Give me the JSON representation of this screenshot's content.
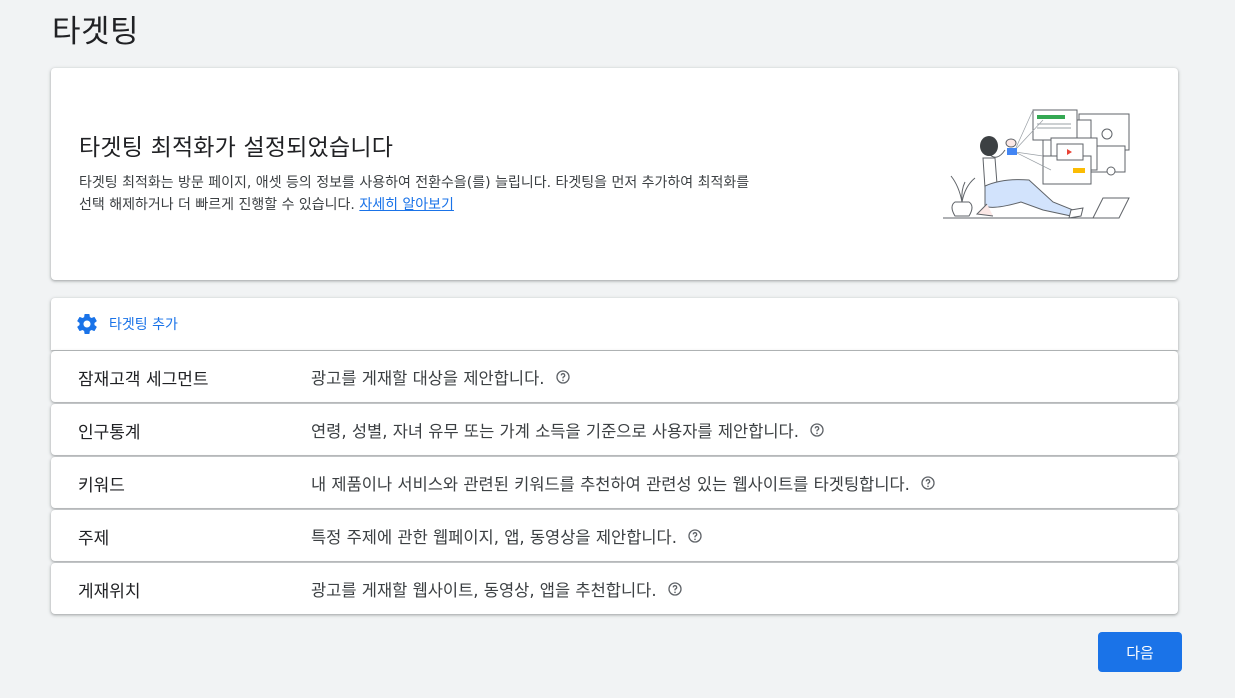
{
  "page": {
    "title": "타겟팅"
  },
  "banner": {
    "heading": "타겟팅 최적화가 설정되었습니다",
    "description_line1": "타겟팅 최적화는 방문 페이지, 애셋 등의 정보를 사용하여 전환수을(를) 늘립니다. 타겟팅을 먼저 추가하여 최적화를",
    "description_line2": "선택 해제하거나 더 빠르게 진행할 수 있습니다.",
    "learn_more": "자세히 알아보기"
  },
  "add_targeting": {
    "label": "타겟팅 추가",
    "icon": "gear-icon"
  },
  "targeting_rows": [
    {
      "name": "잠재고객 세그먼트",
      "description": "광고를 게재할 대상을 제안합니다."
    },
    {
      "name": "인구통계",
      "description": "연령, 성별, 자녀 유무 또는 가계 소득을 기준으로 사용자를 제안합니다."
    },
    {
      "name": "키워드",
      "description": "내 제품이나 서비스와 관련된 키워드를 추천하여 관련성 있는 웹사이트를 타겟팅합니다."
    },
    {
      "name": "주제",
      "description": "특정 주제에 관한 웹페이지, 앱, 동영상을 제안합니다."
    },
    {
      "name": "게재위치",
      "description": "광고를 게재할 웹사이트, 동영상, 앱을 추천합니다."
    }
  ],
  "next_button": {
    "label": "다음"
  },
  "colors": {
    "accent": "#1a73e8",
    "background": "#f1f3f4",
    "card": "#ffffff"
  }
}
